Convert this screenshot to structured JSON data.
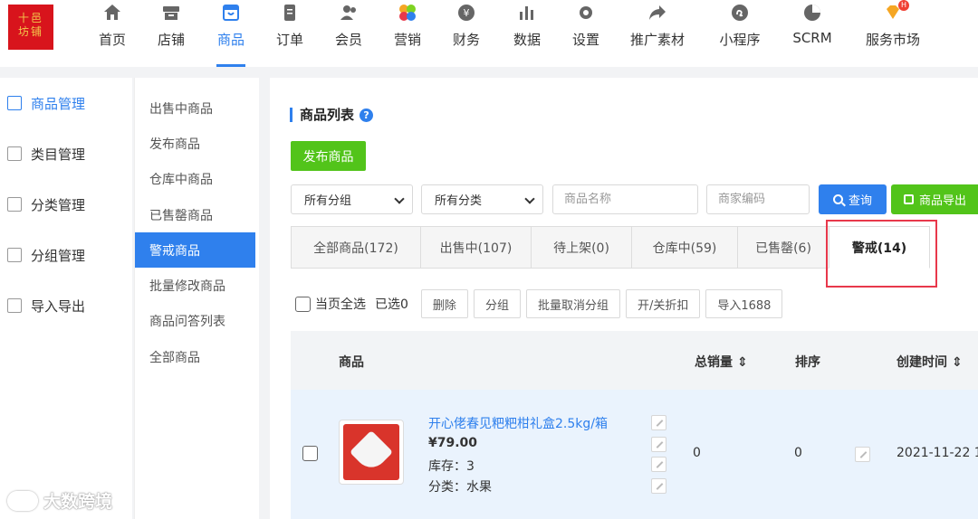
{
  "logo": {
    "text_line1": "十邑",
    "text_line2": "坊铺"
  },
  "nav": [
    {
      "label": "首页",
      "icon": "home-icon"
    },
    {
      "label": "店铺",
      "icon": "shop-icon"
    },
    {
      "label": "商品",
      "icon": "bag-icon",
      "active": true
    },
    {
      "label": "订单",
      "icon": "order-icon"
    },
    {
      "label": "会员",
      "icon": "member-icon"
    },
    {
      "label": "营销",
      "icon": "marketing-icon"
    },
    {
      "label": "财务",
      "icon": "finance-icon"
    },
    {
      "label": "数据",
      "icon": "chart-icon"
    },
    {
      "label": "设置",
      "icon": "gear-icon"
    },
    {
      "label": "推广素材",
      "icon": "share-icon"
    },
    {
      "label": "小程序",
      "icon": "miniapp-icon"
    },
    {
      "label": "SCRM",
      "icon": "pie-icon"
    },
    {
      "label": "服务市场",
      "icon": "diamond-icon"
    }
  ],
  "sidebar": [
    {
      "label": "商品管理",
      "active": true
    },
    {
      "label": "类目管理"
    },
    {
      "label": "分类管理"
    },
    {
      "label": "分组管理"
    },
    {
      "label": "导入导出"
    }
  ],
  "subsidebar": [
    {
      "label": "出售中商品"
    },
    {
      "label": "发布商品"
    },
    {
      "label": "仓库中商品"
    },
    {
      "label": "已售罄商品"
    },
    {
      "label": "警戒商品",
      "active": true
    },
    {
      "label": "批量修改商品"
    },
    {
      "label": "商品问答列表"
    },
    {
      "label": "全部商品"
    }
  ],
  "main": {
    "title": "商品列表",
    "publish_button": "发布商品",
    "group_select": "所有分组",
    "category_select": "所有分类",
    "name_placeholder": "商品名称",
    "code_placeholder": "商家编码",
    "query_button": "查询",
    "export_button": "商品导出",
    "tabs": [
      {
        "label": "全部商品(172)"
      },
      {
        "label": "出售中(107)"
      },
      {
        "label": "待上架(0)"
      },
      {
        "label": "仓库中(59)"
      },
      {
        "label": "已售罄(6)"
      },
      {
        "label": "警戒(14)",
        "active": true
      }
    ],
    "toolbar": {
      "select_all": "当页全选",
      "selected": "已选0",
      "buttons": [
        "删除",
        "分组",
        "批量取消分组",
        "开/关折扣",
        "导入1688"
      ]
    },
    "table": {
      "headers": {
        "product": "商品",
        "sales": "总销量 ⇕",
        "sort": "排序",
        "created": "创建时间 ⇕"
      },
      "rows": [
        {
          "name": "开心佬春见粑粑柑礼盒2.5kg/箱",
          "price": "¥79.00",
          "stock": "库存：3",
          "category": "分类：水果",
          "sales": "0",
          "sort": "0",
          "created": "2021-11-22 1"
        }
      ]
    }
  },
  "watermark": "大数跨境",
  "colors": {
    "accent": "#2f80ed",
    "green": "#52c41a",
    "highlight": "#e8384b"
  }
}
